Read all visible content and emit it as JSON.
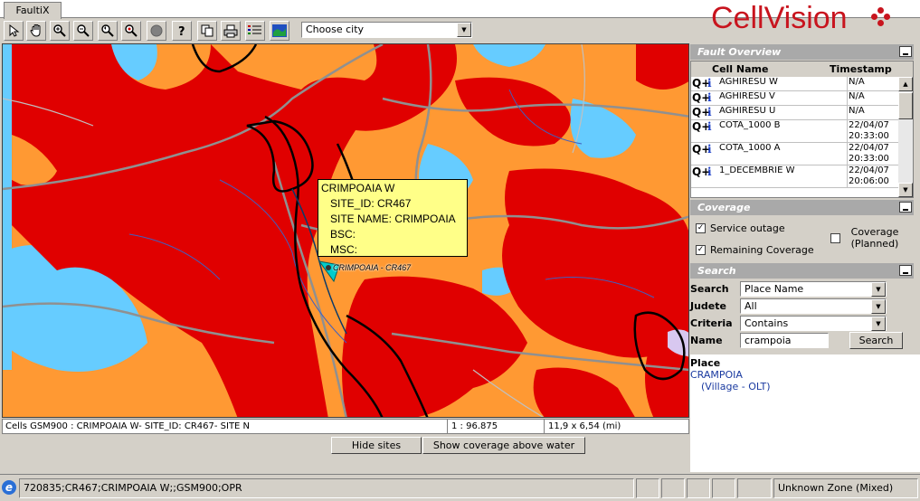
{
  "app": {
    "tab_label": "FaultiX",
    "logo_text": "CellVision",
    "brand_color": "#c8141e"
  },
  "toolbar": {
    "tools": [
      "pointer-icon",
      "hand-pan-icon",
      "zoom-in-icon",
      "zoom-out-icon",
      "zoom-previous-icon",
      "zoom-extent-icon",
      "stop-icon",
      "help-icon",
      "copy-icon",
      "print-icon",
      "legend-icon",
      "map-layer-icon"
    ],
    "city_placeholder": "Choose city"
  },
  "map": {
    "tooltip": {
      "title": "CRIMPOAIA W",
      "site_id": "SITE_ID: CR467",
      "site_name": "SITE NAME: CRIMPOAIA",
      "bsc": "BSC:",
      "msc": "MSC:"
    },
    "site_label": "CRIMPOAIA - CR467",
    "colors": {
      "outage": "#e00000",
      "remaining": "#ff9933",
      "water": "#66ccff"
    }
  },
  "map_status": {
    "cells": "Cells GSM900 : CRIMPOAIA W-   SITE_ID: CR467-   SITE N",
    "scale": "1 : 96.875",
    "extent": "11,9 x 6,54 (mi)"
  },
  "map_buttons": {
    "hide_sites": "Hide sites",
    "show_coverage": "Show coverage above water"
  },
  "fault_overview": {
    "title": "Fault Overview",
    "col_cell": "Cell Name",
    "col_time": "Timestamp",
    "rows": [
      {
        "cell": "AGHIRESU W",
        "ts1": "N/A",
        "ts2": ""
      },
      {
        "cell": "AGHIRESU V",
        "ts1": "N/A",
        "ts2": ""
      },
      {
        "cell": "AGHIRESU U",
        "ts1": "N/A",
        "ts2": ""
      },
      {
        "cell": "COTA_1000 B",
        "ts1": "22/04/07",
        "ts2": "20:33:00"
      },
      {
        "cell": "COTA_1000 A",
        "ts1": "22/04/07",
        "ts2": "20:33:00"
      },
      {
        "cell": "1_DECEMBRIE W",
        "ts1": "22/04/07",
        "ts2": "20:06:00"
      }
    ]
  },
  "coverage": {
    "title": "Coverage",
    "service_outage": "Service outage",
    "service_outage_checked": true,
    "remaining": "Remaining Coverage",
    "remaining_checked": true,
    "planned": "Coverage (Planned)",
    "planned_checked": false
  },
  "search": {
    "title": "Search",
    "search_label": "Search",
    "search_value": "Place Name",
    "judete_label": "Judete",
    "judete_value": "All",
    "criteria_label": "Criteria",
    "criteria_value": "Contains",
    "name_label": "Name",
    "name_value": "crampoia",
    "button": "Search"
  },
  "results": {
    "header": "Place",
    "name": "CRAMPOIA",
    "detail": "(Village - OLT)"
  },
  "statusbar": {
    "info": "720835;CR467;CRIMPOAIA W;;GSM900;OPR",
    "zone": "Unknown Zone (Mixed)"
  }
}
